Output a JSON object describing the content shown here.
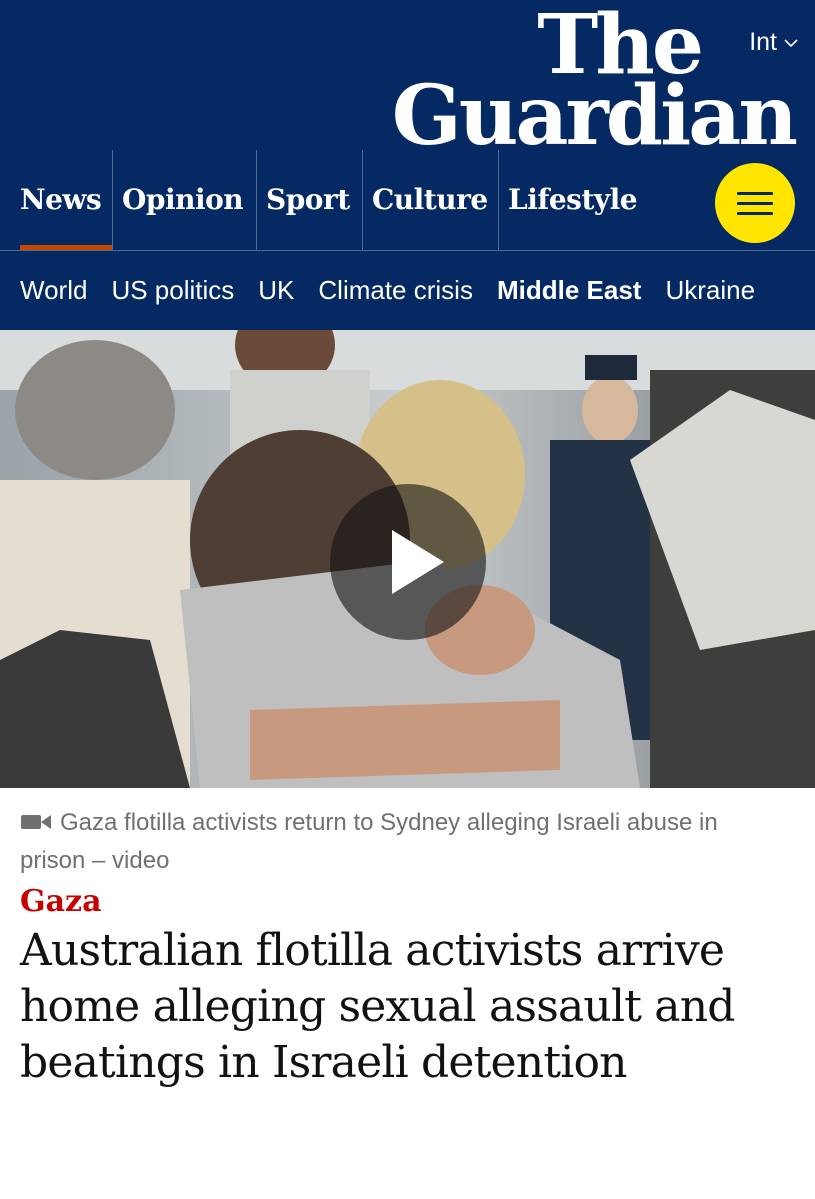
{
  "header": {
    "edition": "Int",
    "logo_line1": "The",
    "logo_line2": "Guardian",
    "brand_color": "#052962",
    "accent_color": "#ffe500",
    "pillars": [
      "News",
      "Opinion",
      "Sport",
      "Culture",
      "Lifestyle"
    ],
    "active_pillar": "News",
    "subnav": [
      "World",
      "US politics",
      "UK",
      "Climate crisis",
      "Middle East",
      "Ukraine"
    ],
    "active_subnav": "Middle East"
  },
  "media": {
    "type": "video",
    "icon": "video-camera-icon",
    "caption": "Gaza flotilla activists return to Sydney alleging Israeli abuse in prison – video"
  },
  "article": {
    "kicker": "Gaza",
    "kicker_color": "#c70000",
    "headline": "Australian flotilla activists arrive home alleging sexual assault and beatings in Israeli detention"
  }
}
